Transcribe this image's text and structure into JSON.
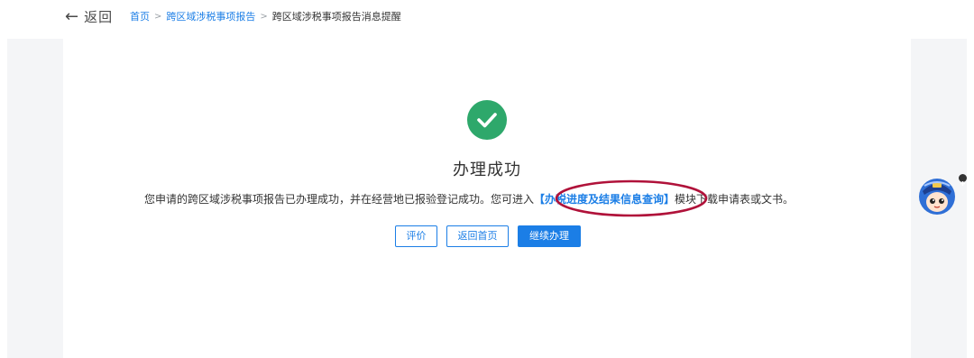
{
  "header": {
    "back_arrow": "←",
    "back_label": "返回",
    "breadcrumb": {
      "home": "首页",
      "separator": ">",
      "section": "跨区域涉税事项报告",
      "current": "跨区域涉税事项报告消息提醒"
    }
  },
  "result": {
    "icon": "check-circle-icon",
    "icon_color": "#2ea86b",
    "title": "办理成功",
    "message_before": "您申请的跨区域涉税事项报告已办理成功，并在经营地已报验登记成功。您可进入",
    "message_link": "【办税进度及结果信息查询】",
    "message_after": "模块下载申请表或文书。",
    "highlight_color": "#b0123a"
  },
  "actions": {
    "evaluate": "评价",
    "back_home": "返回首页",
    "continue": "继续办理"
  },
  "assistant": {
    "icon": "assistant-avatar-icon",
    "badge_icon": "plus-icon"
  },
  "colors": {
    "accent": "#1b7ee6",
    "success": "#2ea86b",
    "side_panel": "#f4f5f7"
  }
}
